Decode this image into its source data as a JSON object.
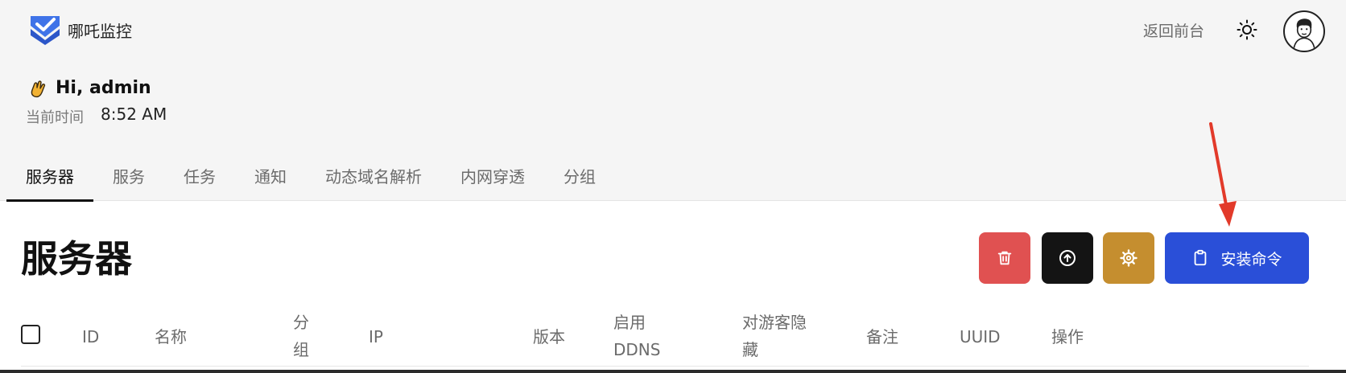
{
  "header": {
    "app_title": "哪吒监控",
    "back_link": "返回前台"
  },
  "greeting": {
    "text": "Hi, admin",
    "time_label": "当前时间",
    "time_value": "8:52 AM"
  },
  "tabs": [
    {
      "label": "服务器",
      "active": true
    },
    {
      "label": "服务",
      "active": false
    },
    {
      "label": "任务",
      "active": false
    },
    {
      "label": "通知",
      "active": false
    },
    {
      "label": "动态域名解析",
      "active": false
    },
    {
      "label": "内网穿透",
      "active": false
    },
    {
      "label": "分组",
      "active": false
    }
  ],
  "main": {
    "page_title": "服务器",
    "install_label": "安装命令"
  },
  "table": {
    "columns": [
      {
        "line1": "ID",
        "line2": ""
      },
      {
        "line1": "名称",
        "line2": ""
      },
      {
        "line1": "分",
        "line2": "组"
      },
      {
        "line1": "IP",
        "line2": ""
      },
      {
        "line1": "版本",
        "line2": ""
      },
      {
        "line1": "启用",
        "line2": "DDNS"
      },
      {
        "line1": "对游客隐",
        "line2": "藏"
      },
      {
        "line1": "备注",
        "line2": ""
      },
      {
        "line1": "UUID",
        "line2": ""
      },
      {
        "line1": "操作",
        "line2": ""
      }
    ]
  },
  "colors": {
    "delete": "#e05151",
    "upload": "#141414",
    "settings": "#c58e2f",
    "install": "#2a4fd8",
    "annotation_arrow": "#e23a2a"
  },
  "icons": {
    "logo": "shield-check-icon",
    "theme": "sun-icon",
    "greeting": "waving-hand-icon",
    "delete": "trash-icon",
    "upload": "circle-arrow-up-icon",
    "settings": "gear-icon",
    "install": "clipboard-icon"
  }
}
